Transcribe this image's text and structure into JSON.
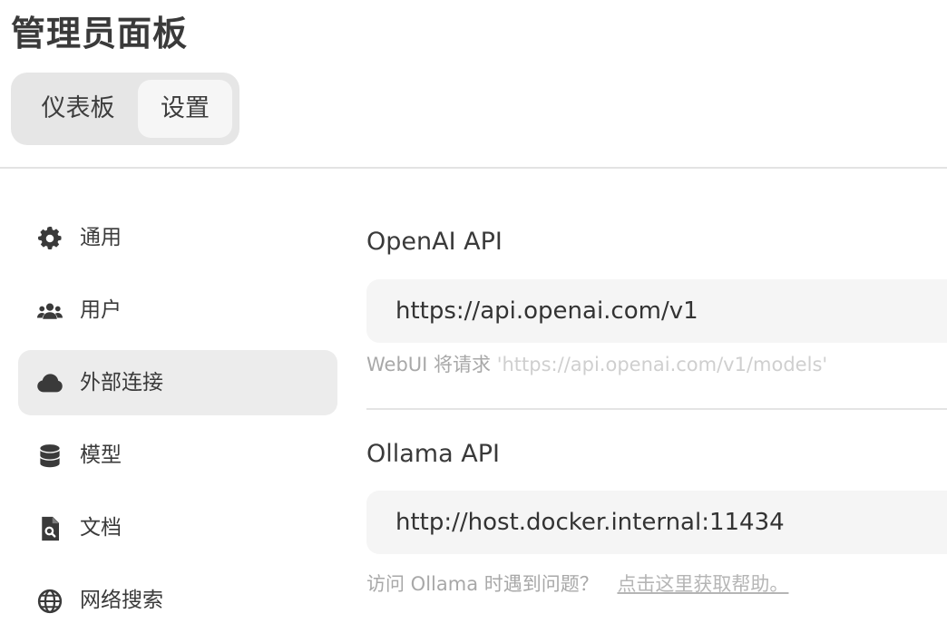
{
  "header": {
    "title": "管理员面板"
  },
  "top_tabs": [
    {
      "label": "仪表板",
      "active": false
    },
    {
      "label": "设置",
      "active": true
    }
  ],
  "sidebar": {
    "items": [
      {
        "label": "通用",
        "icon": "gear-icon"
      },
      {
        "label": "用户",
        "icon": "users-icon"
      },
      {
        "label": "外部连接",
        "icon": "cloud-icon",
        "active": true
      },
      {
        "label": "模型",
        "icon": "database-icon"
      },
      {
        "label": "文档",
        "icon": "document-search-icon"
      },
      {
        "label": "网络搜索",
        "icon": "globe-icon"
      }
    ]
  },
  "connections": {
    "openai": {
      "label": "OpenAI API",
      "url_value": "https://api.openai.com/v1",
      "hint_prefix": "WebUI 将请求",
      "hint_url": "'https://api.openai.com/v1/models'"
    },
    "ollama": {
      "label": "Ollama API",
      "url_value": "http://host.docker.internal:11434",
      "hint_prefix": "访问 Ollama 时遇到问题？",
      "help_link": "点击这里获取帮助。"
    }
  },
  "colors": {
    "active_bg": "#ececec",
    "tab_bg": "#e6e6e6",
    "field_bg": "#f5f5f5"
  }
}
